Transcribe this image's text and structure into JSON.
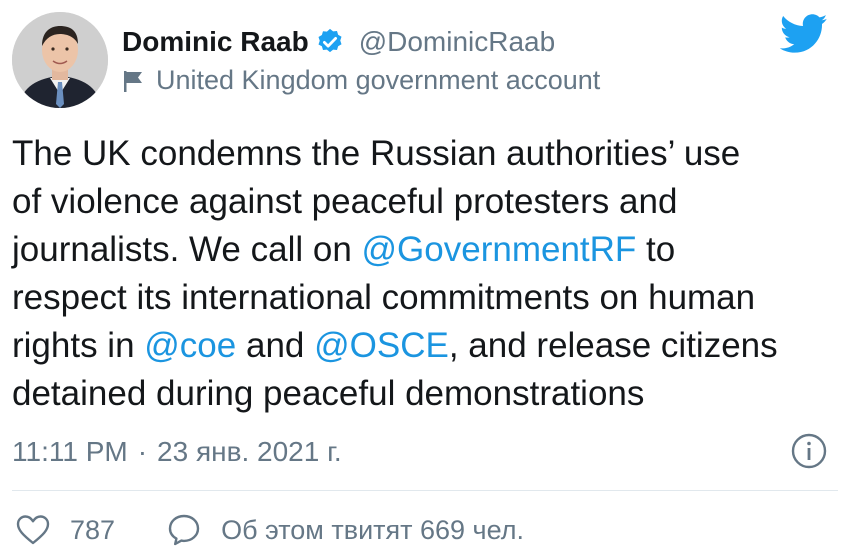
{
  "author": {
    "display_name": "Dominic Raab",
    "handle": "@DominicRaab",
    "label": "United Kingdom government account",
    "verified": true
  },
  "tweet": {
    "line1": "The UK condemns the Russian authorities’ use",
    "line2": "of violence against peaceful protesters and",
    "line3_a": "journalists. We call on ",
    "line3_mention": "@GovernmentRF",
    "line3_b": " to",
    "line4": "respect its international commitments on human",
    "line5_a": "rights in ",
    "line5_mention1": "@coe",
    "line5_b": " and ",
    "line5_mention2": "@OSCE",
    "line5_c": ", and release citizens",
    "line6": "detained during peaceful demonstrations"
  },
  "meta": {
    "time": "11:11 PM",
    "separator": "·",
    "date": "23 янв. 2021 г."
  },
  "actions": {
    "likes": "787",
    "discussion": "Об этом твитят 669 чел."
  },
  "icons": {
    "verified": "verified-badge-icon",
    "flag": "flag-icon",
    "bird": "twitter-bird-icon",
    "info": "info-icon",
    "heart": "heart-icon",
    "bubble": "speech-bubble-icon"
  },
  "colors": {
    "text": "#14171a",
    "secondary": "#657786",
    "link": "#1b95e0",
    "brand": "#1da1f2",
    "divider": "#e1e8ed"
  }
}
